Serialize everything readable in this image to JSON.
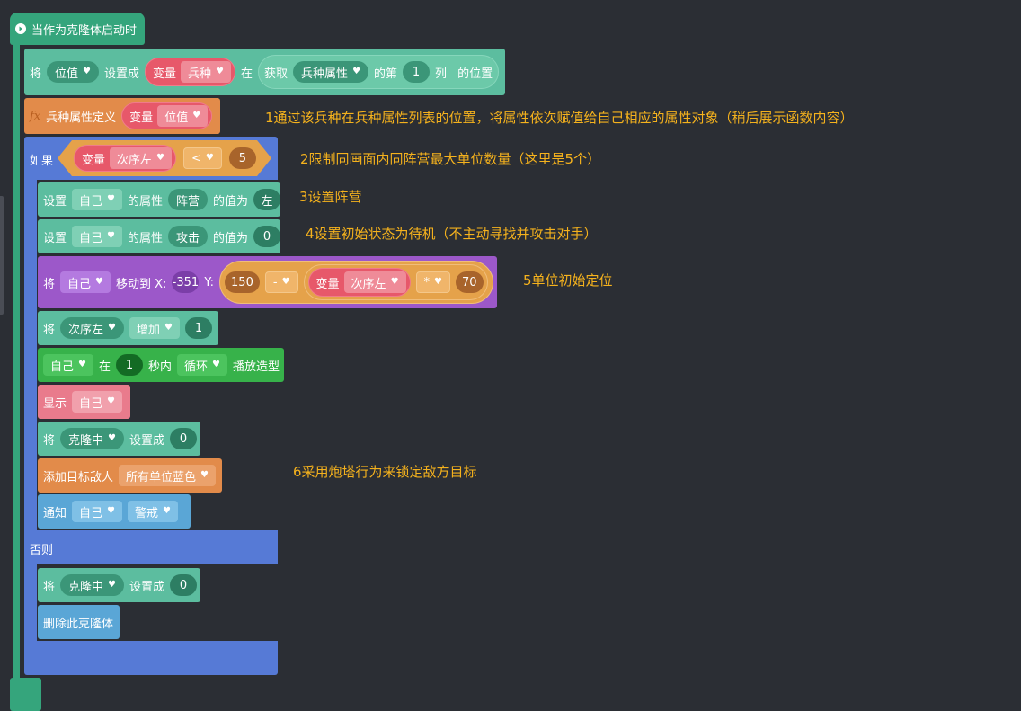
{
  "hat": {
    "label": "当作为克隆体启动时"
  },
  "set_pos": {
    "kw_set": "将",
    "var": "位值",
    "kw_to": "设置成",
    "var_kw": "变量",
    "var_name": "兵种",
    "kw_in": "在",
    "get_kw": "获取",
    "list": "兵种属性",
    "kw_nth": "的第",
    "index": "1",
    "kw_col": "列",
    "kw_pos": "的位置"
  },
  "func_def": {
    "fx": "fx",
    "label": "兵种属性定义",
    "var_kw": "变量",
    "var_name": "位值"
  },
  "if_block": {
    "kw_if": "如果",
    "var_kw": "变量",
    "var_name": "次序左",
    "op": "<",
    "value": "5",
    "kw_else": "否则"
  },
  "set_camp": {
    "kw": "设置",
    "target": "自己",
    "kw_attr": "的属性",
    "attr": "阵营",
    "kw_val": "的值为",
    "value": "左"
  },
  "set_attack": {
    "kw": "设置",
    "target": "自己",
    "kw_attr": "的属性",
    "attr": "攻击",
    "kw_val": "的值为",
    "value": "0"
  },
  "move": {
    "kw": "将",
    "target": "自己",
    "kw_move": "移动到 X:",
    "x": "-351",
    "kw_y": "Y:",
    "base": "150",
    "op1": "-",
    "var_kw": "变量",
    "var_name": "次序左",
    "op2": "*",
    "mult": "70"
  },
  "increase": {
    "kw": "将",
    "var": "次序左",
    "mode": "增加",
    "value": "1"
  },
  "anim": {
    "target": "自己",
    "kw_in": "在",
    "secs": "1",
    "kw_secs": "秒内",
    "mode": "循环",
    "kw_play": "播放造型"
  },
  "show": {
    "kw": "显示",
    "target": "自己"
  },
  "set_clone": {
    "kw": "将",
    "var": "克隆中",
    "kw_to": "设置成",
    "value": "0"
  },
  "add_enemy": {
    "kw": "添加目标敌人",
    "target": "所有单位蓝色"
  },
  "notify": {
    "kw": "通知",
    "target": "自己",
    "msg": "警戒"
  },
  "else_set_clone": {
    "kw": "将",
    "var": "克隆中",
    "kw_to": "设置成",
    "value": "0"
  },
  "delete_clone": {
    "label": "删除此克隆体"
  },
  "notes": [
    "1通过该兵种在兵种属性列表的位置，将属性依次赋值给自己相应的属性对象（稍后展示函数内容）",
    "2限制同画面内同阵营最大单位数量（这里是5个）",
    "3设置阵营",
    "4设置初始状态为待机（不主动寻找并攻击对手）",
    "5单位初始定位",
    "6采用炮塔行为来锁定敌方目标"
  ],
  "colors": {
    "teal": "#5cbd9f",
    "red": "#e7586a",
    "orange": "#e28b4a",
    "blue": "#567ad6",
    "purple": "#9c58c9",
    "green": "#37b24a",
    "pink": "#e97b8c",
    "sky": "#5aa6d6",
    "note": "#f5b21d",
    "background": "#2b2e34"
  }
}
